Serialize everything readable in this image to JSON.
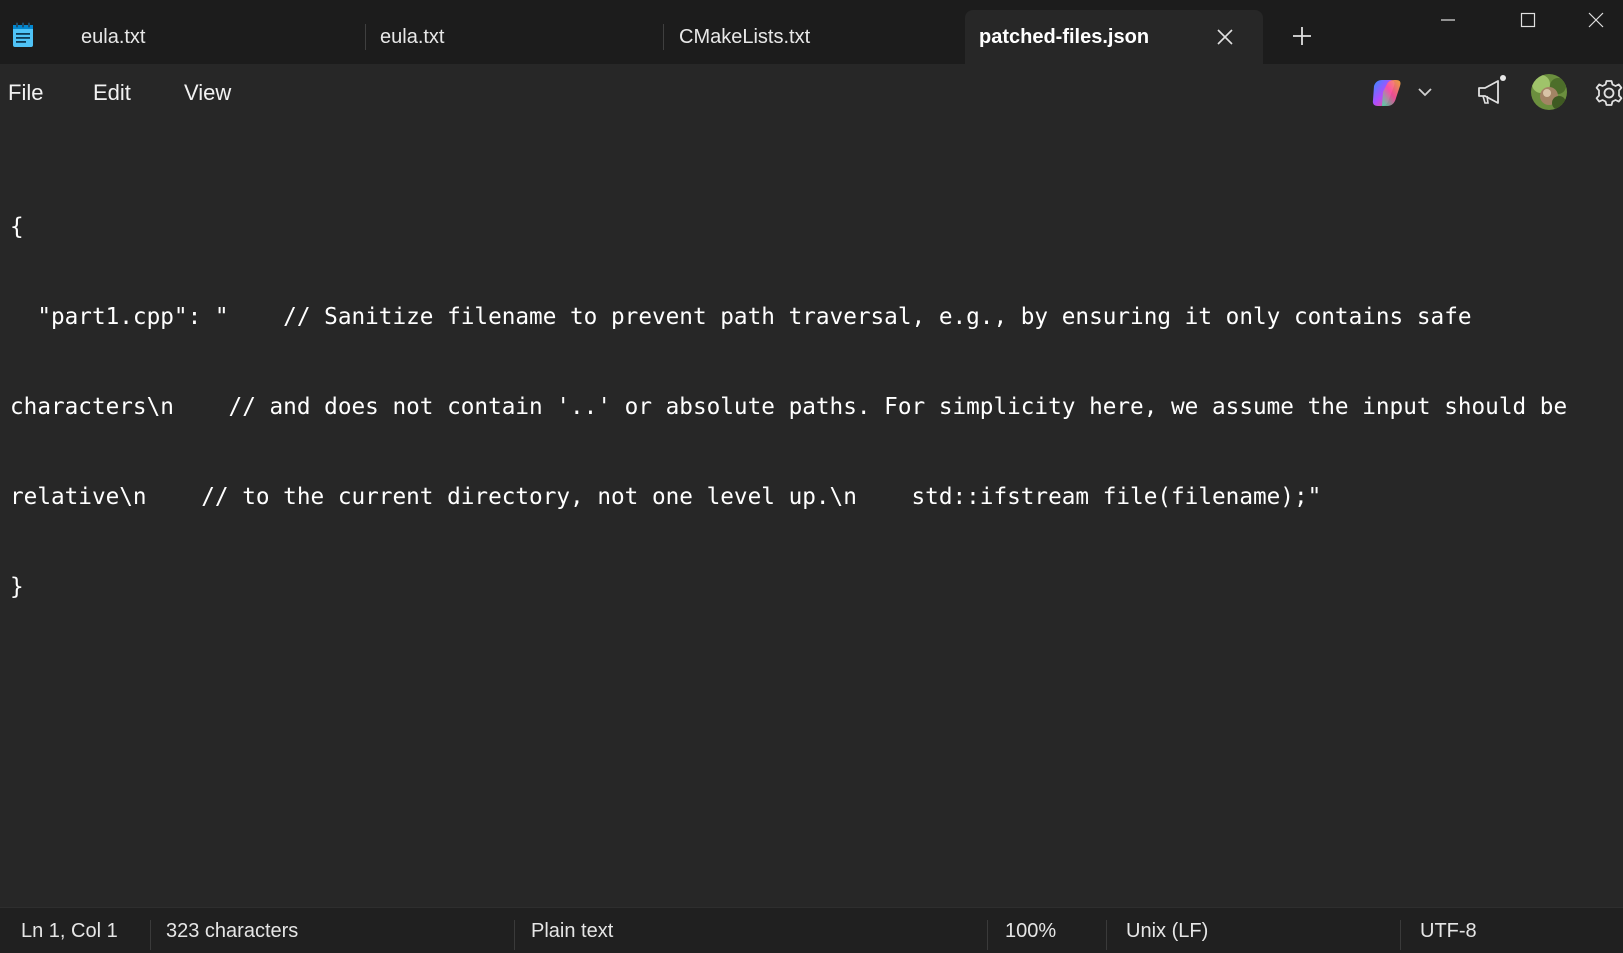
{
  "tabs": [
    {
      "label": "eula.txt",
      "active": false
    },
    {
      "label": "eula.txt",
      "active": false
    },
    {
      "label": "CMakeLists.txt",
      "active": false
    },
    {
      "label": "patched-files.json",
      "active": true
    }
  ],
  "menu": {
    "file": "File",
    "edit": "Edit",
    "view": "View"
  },
  "icons": {
    "app": "notepad-icon",
    "tab_close": "close-icon",
    "new_tab": "plus-icon",
    "minimize": "minimize-icon",
    "maximize": "maximize-icon",
    "close": "close-icon",
    "copilot": "copilot-icon",
    "announcements": "megaphone-icon",
    "settings": "gear-icon"
  },
  "editor": {
    "lines": [
      "{",
      "  \"part1.cpp\": \"    // Sanitize filename to prevent path traversal, e.g., by ensuring it only contains safe",
      "characters\\n    // and does not contain '..' or absolute paths. For simplicity here, we assume the input should be",
      "relative\\n    // to the current directory, not one level up.\\n    std::ifstream file(filename);\"",
      "}"
    ]
  },
  "status": {
    "position": "Ln 1, Col 1",
    "characters": "323 characters",
    "file_type": "Plain text",
    "zoom": "100%",
    "line_ending": "Unix (LF)",
    "encoding": "UTF-8"
  },
  "colors": {
    "titlebar_bg": "#1c1c1c",
    "editor_bg": "#272727",
    "statusbar_bg": "#202020",
    "text": "#ffffff"
  }
}
